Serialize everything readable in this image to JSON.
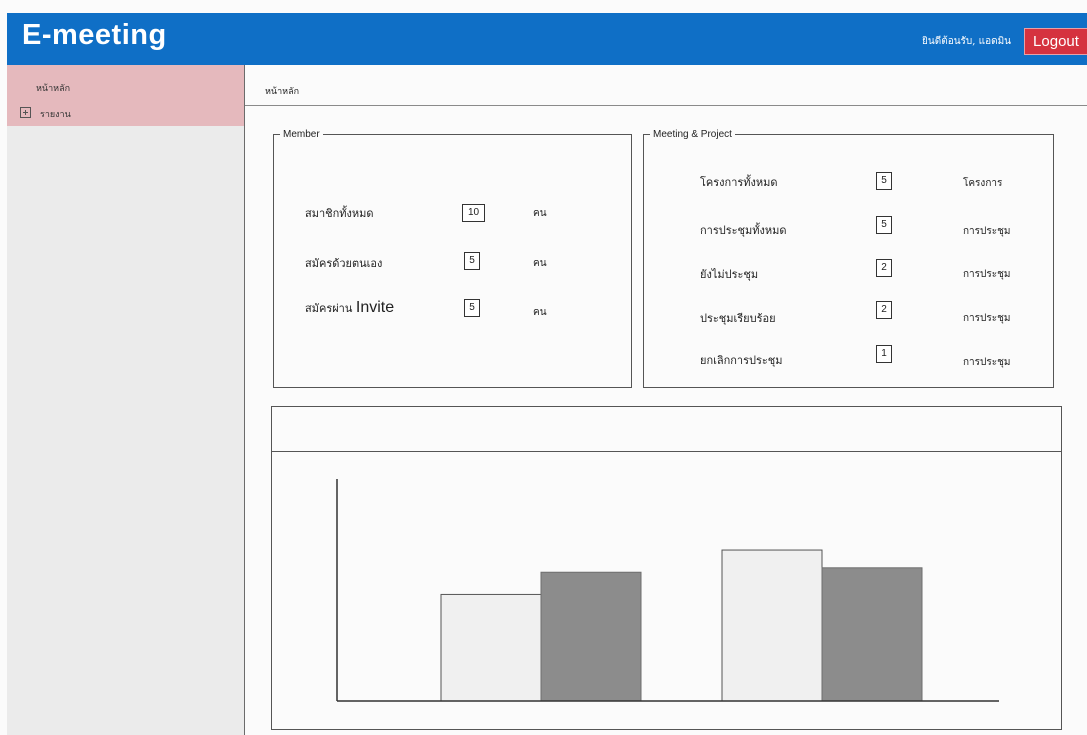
{
  "header": {
    "app_title": "E-meeting",
    "welcome_text": "ยินดีต้อนรับ, แอดมิน",
    "logout_label": "Logout"
  },
  "sidebar": {
    "items": [
      {
        "label": "หน้าหลัก",
        "expandable": false
      },
      {
        "label": "รายงาน",
        "expandable": true,
        "icon": "plus-box-icon"
      }
    ]
  },
  "breadcrumb": {
    "current": "หน้าหลัก"
  },
  "member_panel": {
    "legend": "Member",
    "rows": [
      {
        "label": "สมาชิกทั้งหมด",
        "value": "10",
        "unit": "คน"
      },
      {
        "label": "สมัครด้วยตนเอง",
        "value": "5",
        "unit": "คน"
      },
      {
        "label_prefix": "สมัครผ่าน",
        "label_latin": "Invite",
        "value": "5",
        "unit": "คน"
      }
    ]
  },
  "meeting_panel": {
    "legend": "Meeting & Project",
    "rows": [
      {
        "label": "โครงการทั้งหมด",
        "value": "5",
        "unit": "โครงการ"
      },
      {
        "label": "การประชุมทั้งหมด",
        "value": "5",
        "unit": "การประชุม"
      },
      {
        "label": "ยังไม่ประชุม",
        "value": "2",
        "unit": "การประชุม"
      },
      {
        "label": "ประชุมเรียบร้อย",
        "value": "2",
        "unit": "การประชุม"
      },
      {
        "label": "ยกเลิกการประชุม",
        "value": "1",
        "unit": "การประชุม"
      }
    ]
  },
  "colors": {
    "header_bg": "#0f6fc6",
    "logout_bg": "#d5323f",
    "sidebar_active": "#e5b9bd",
    "bar_light": "#f0f0f0",
    "bar_dark": "#8c8c8c"
  },
  "chart_data": {
    "type": "bar",
    "title": "",
    "xlabel": "",
    "ylabel": "",
    "categories": [
      "",
      ""
    ],
    "series": [
      {
        "values": [
          48,
          68
        ]
      },
      {
        "values": [
          58,
          60
        ]
      }
    ],
    "ylim": [
      0,
      100
    ],
    "grid": false,
    "legend": "none"
  }
}
